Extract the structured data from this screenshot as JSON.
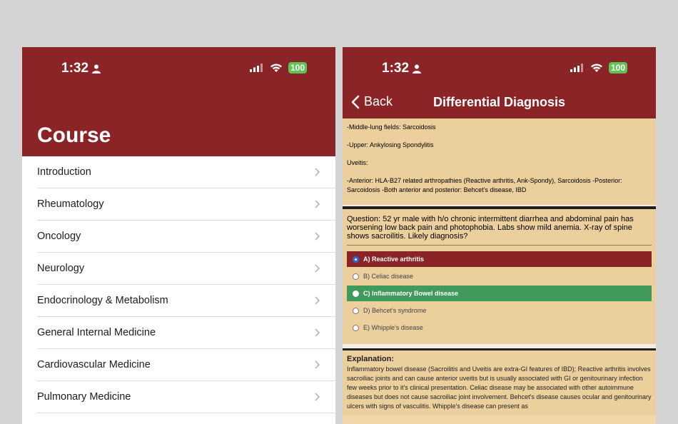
{
  "left": {
    "status": {
      "time": "1:32",
      "battery": "100"
    },
    "title": "Course",
    "items": [
      {
        "label": "Introduction"
      },
      {
        "label": "Rheumatology"
      },
      {
        "label": "Oncology"
      },
      {
        "label": "Neurology"
      },
      {
        "label": "Endocrinology & Metabolism"
      },
      {
        "label": "General Internal Medicine"
      },
      {
        "label": "Cardiovascular Medicine"
      },
      {
        "label": "Pulmonary Medicine"
      }
    ]
  },
  "right": {
    "status": {
      "time": "1:32",
      "battery": "100"
    },
    "nav": {
      "back_label": "Back",
      "title": "Differential Diagnosis"
    },
    "notes": [
      "-Middle-lung fields: Sarcoidosis",
      "-Upper: Ankylosing Spondylitis",
      "Uveitis:",
      "-Anterior: HLA-B27 related arthropathies (Reactive arthritis, Ank-Spondy), Sarcoidosis -Posterior: Sarcoidosis -Both anterior and posterior: Behcet's disease, IBD"
    ],
    "question": "Question: 52 yr male with h/o chronic intermittent diarrhea and abdominal pain has worsening low back pain and photophobia. Labs show mild anemia. X-ray of spine shows sacroilitis. Likely diagnosis?",
    "options": [
      {
        "label": "A) Reactive arthritis",
        "state": "wrong"
      },
      {
        "label": "B) Celiac disease",
        "state": "none"
      },
      {
        "label": "C) Inflammatory Bowel disease",
        "state": "correct"
      },
      {
        "label": "D) Behcet's syndrome",
        "state": "none"
      },
      {
        "label": "E) Whipple's disease",
        "state": "none"
      }
    ],
    "explanation": {
      "title": "Explanation:",
      "text": "Inflammatory bowel disease (Sacroilitis and Uveitis are extra-GI features of IBD); Reactive arthritis involves sacroiliac joints and can cause anterior uveitis but is usually associated with GI or genitourinary infection few weeks prior to it's clinical presentation. Celiac disease may be associated with other autoimmune diseases but does not cause sacroiliac joint involvement. Behcet's disease causes ocular and genitourinary ulcers with signs of vasculitis. Whipple's disease can present as"
    }
  },
  "colors": {
    "header": "#8b2427",
    "card": "#ebcf9d",
    "correct": "#3f9a5c",
    "battery": "#5ec453"
  }
}
